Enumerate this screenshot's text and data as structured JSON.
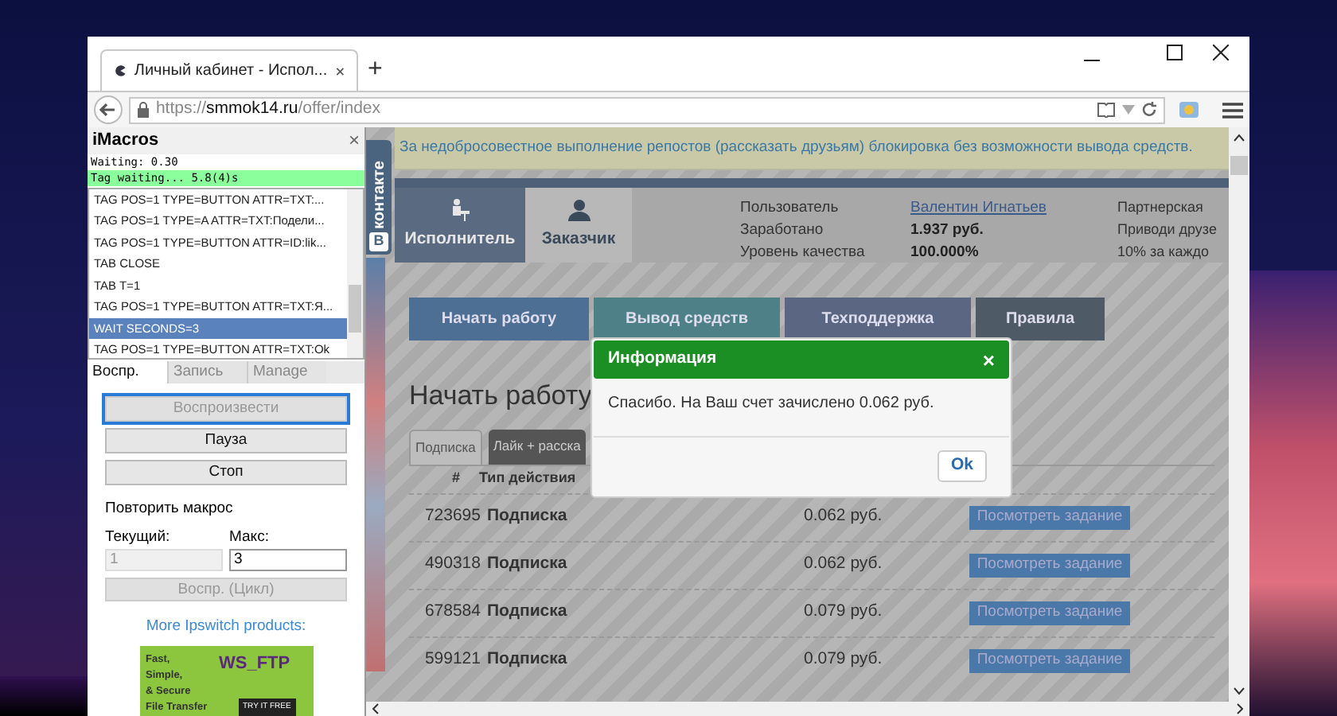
{
  "browser": {
    "tab_title": "Личный кабинет - Испол...",
    "new_tab": "+",
    "url_scheme": "https://",
    "url_host": "smmok14.ru",
    "url_path": "/offer/index"
  },
  "imacros": {
    "title": "iMacros",
    "close": "×",
    "status_lines": [
      {
        "text": "Waiting: 0.30",
        "kind": "plain"
      },
      {
        "text": "Tag waiting... 5.8(4)s",
        "kind": "highlight"
      }
    ],
    "macro_lines": [
      {
        "text": "TAG POS=1 TYPE=BUTTON ATTR=TXT:...",
        "selected": false
      },
      {
        "text": "TAG POS=1 TYPE=A ATTR=TXT:Подели...",
        "selected": false
      },
      {
        "text": "TAG POS=1 TYPE=BUTTON ATTR=ID:lik...",
        "selected": false
      },
      {
        "text": "TAB CLOSE",
        "selected": false
      },
      {
        "text": "TAB T=1",
        "selected": false
      },
      {
        "text": "TAG POS=1 TYPE=BUTTON ATTR=TXT:Я...",
        "selected": false
      },
      {
        "text": "WAIT SECONDS=3",
        "selected": true
      },
      {
        "text": "TAG POS=1 TYPE=BUTTON ATTR=TXT:Ok",
        "selected": false
      }
    ],
    "tabs": [
      {
        "label": "Воспр.",
        "selected": true
      },
      {
        "label": "Запись",
        "selected": false
      },
      {
        "label": "Manage",
        "selected": false
      }
    ],
    "buttons": [
      {
        "label": "Воспроизвести",
        "disabled": true
      },
      {
        "label": "Пауза",
        "disabled": false
      },
      {
        "label": "Стоп",
        "disabled": false
      }
    ],
    "repeat_label": "Повторить макрос",
    "current_label": "Текущий:",
    "current_value": "1",
    "max_label": "Макс:",
    "max_value": "3",
    "loop_button": {
      "label": "Воспр. (Цикл)",
      "disabled": true
    },
    "more_link": "More Ipswitch products:",
    "ad": {
      "lines": [
        "Fast,",
        "Simple,",
        "& Secure",
        "File Transfer"
      ],
      "logo": "WS_FTP",
      "cta": "TRY IT FREE"
    }
  },
  "page": {
    "notice": "За недобросовестное выполнение репостов (рассказать друзьям) блокировка без возможности вывода средств.",
    "vk_widget": {
      "logo": "В",
      "label": "контакте"
    },
    "role_tabs": [
      {
        "label": "Исполнитель",
        "selected": true
      },
      {
        "label": "Заказчик",
        "selected": false
      }
    ],
    "user_info": [
      {
        "label": "Пользователь",
        "value": "Валентин Игнатьев",
        "kind": "link"
      },
      {
        "label": "Заработано",
        "value": "1.937 руб.",
        "kind": "bold"
      },
      {
        "label": "Уровень качества",
        "value": "100.000%",
        "kind": "bold"
      }
    ],
    "partner": [
      "Партнерская",
      "Приводи друзе",
      "10% за каждо"
    ],
    "nav": [
      {
        "label": "Начать работу",
        "color": "#4e6f94"
      },
      {
        "label": "Вывод средств",
        "color": "#4e8088"
      },
      {
        "label": "Техподдержка",
        "color": "#5a6682"
      },
      {
        "label": "Правила",
        "color": "#4e5a66"
      }
    ],
    "heading": "Начать работу",
    "task_tabs": [
      {
        "label": "Подписка",
        "selected": true
      },
      {
        "label": "Лайк + расска",
        "selected": false
      }
    ],
    "table": {
      "columns": [
        "#",
        "Тип действия"
      ],
      "rows": [
        {
          "id": "723695",
          "type": "Подписка",
          "price": "0.062 руб.",
          "action": "Посмотреть задание"
        },
        {
          "id": "490318",
          "type": "Подписка",
          "price": "0.062 руб.",
          "action": "Посмотреть задание"
        },
        {
          "id": "678584",
          "type": "Подписка",
          "price": "0.079 руб.",
          "action": "Посмотреть задание"
        },
        {
          "id": "599121",
          "type": "Подписка",
          "price": "0.079 руб.",
          "action": "Посмотреть задание"
        }
      ]
    },
    "dialog": {
      "title": "Информация",
      "close": "×",
      "message": "Спасибо. На Ваш счет зачислено 0.062 руб.",
      "ok": "Ok"
    }
  }
}
